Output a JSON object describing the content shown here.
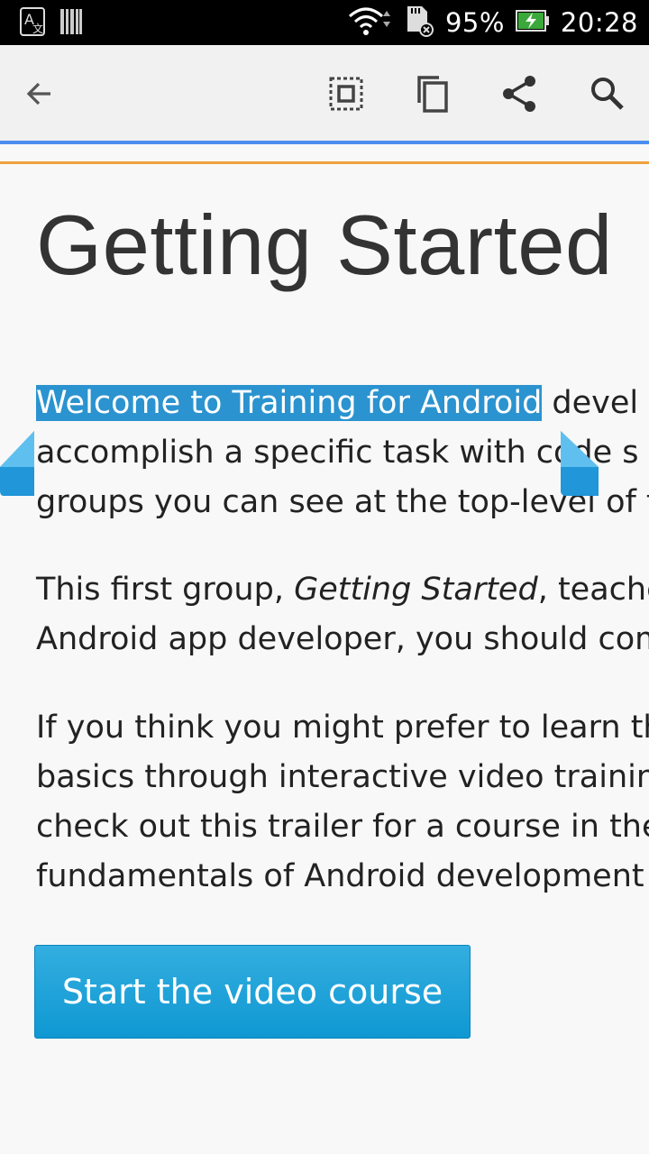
{
  "status_bar": {
    "battery_percent": "95%",
    "time": "20:28",
    "icons": [
      "translate-icon",
      "barcode-icon",
      "wifi-icon",
      "sd-card-error-icon",
      "battery-charging-icon"
    ]
  },
  "toolbar": {
    "icons": [
      "back-arrow-icon",
      "select-all-icon",
      "copy-icon",
      "share-icon",
      "search-icon"
    ]
  },
  "page": {
    "title": "Getting Started",
    "paragraph1": {
      "selected_text": "Welcome to Training for Android",
      "line1_rest": " devel",
      "line2": "accomplish a specific task with code s",
      "line3": "groups you can see at the top-level of t"
    },
    "paragraph2": {
      "line1_before": "This first group, ",
      "line1_italic": "Getting Started",
      "line1_after": ", teache",
      "line2": "Android app developer, you should com"
    },
    "paragraph3": {
      "line1": "If you think you might prefer to learn th",
      "line2": "basics through interactive video trainin",
      "line3": "check out this trailer for a course in the",
      "line4": "fundamentals of Android development"
    },
    "cta_button": "Start the video course"
  },
  "colors": {
    "selection": "#2b93cf",
    "button": "#1aa3d9",
    "accent_blue": "#4c8ef0",
    "accent_orange": "#f0a040"
  }
}
